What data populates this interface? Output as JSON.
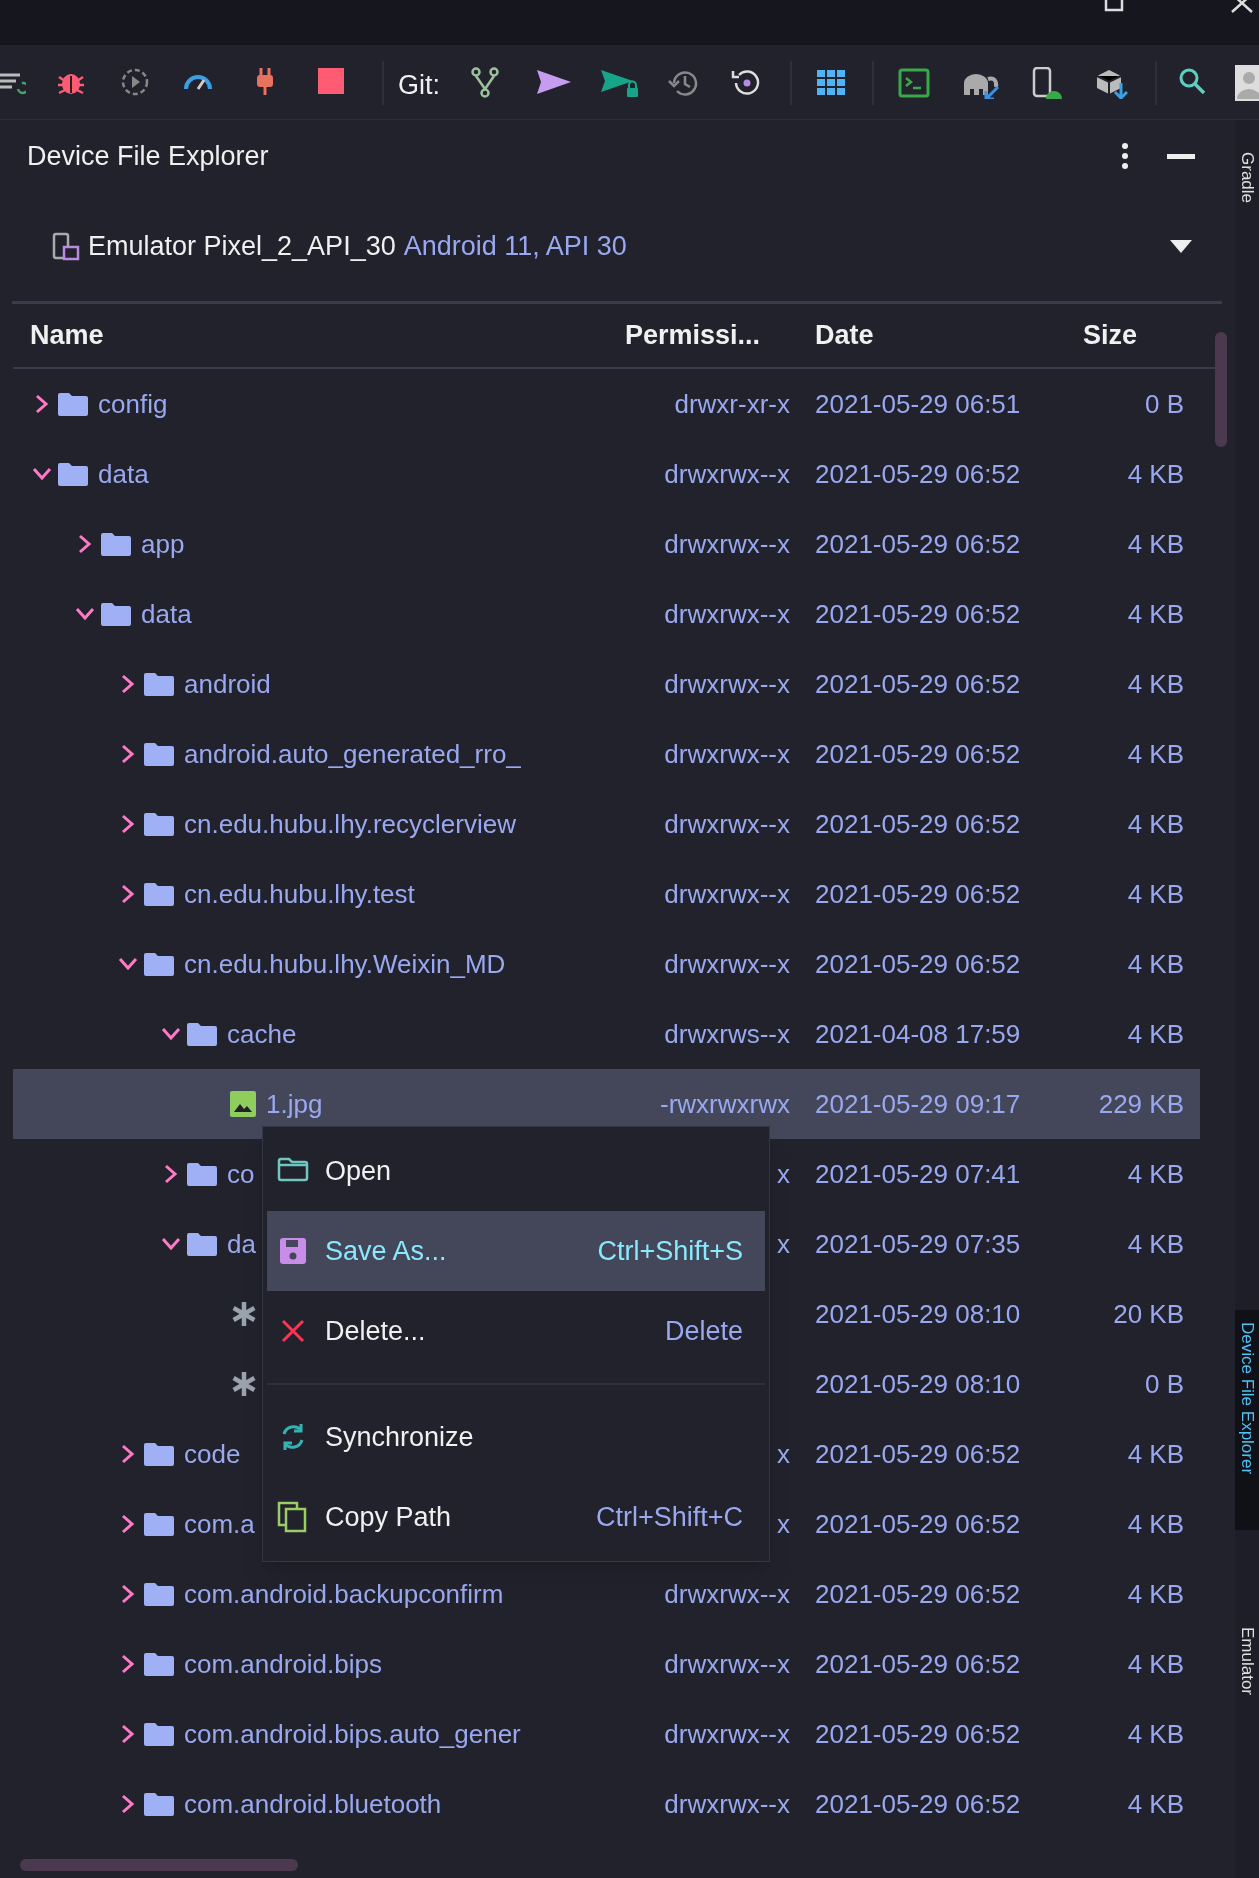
{
  "toolbar": {
    "git_label": "Git:"
  },
  "panel": {
    "title": "Device File Explorer"
  },
  "device": {
    "name": "Emulator Pixel_2_API_30",
    "api": "Android 11, API 30"
  },
  "columns": [
    "Name",
    "Permissi...",
    "Date",
    "Size"
  ],
  "rows": [
    {
      "kind": "folder",
      "name": "config",
      "permissions": "drwxr-xr-x",
      "date": "2021-05-29 06:51",
      "size": "0 B",
      "expanded": false,
      "selected": false
    },
    {
      "kind": "folder",
      "name": "data",
      "permissions": "drwxrwx--x",
      "date": "2021-05-29 06:52",
      "size": "4 KB",
      "expanded": true,
      "selected": false,
      "children": [
        {
          "kind": "folder",
          "name": "app",
          "permissions": "drwxrwx--x",
          "date": "2021-05-29 06:52",
          "size": "4 KB",
          "expanded": false,
          "selected": false
        },
        {
          "kind": "folder",
          "name": "data",
          "permissions": "drwxrwx--x",
          "date": "2021-05-29 06:52",
          "size": "4 KB",
          "expanded": true,
          "selected": false,
          "children": [
            {
              "kind": "folder",
              "name": "android",
              "permissions": "drwxrwx--x",
              "date": "2021-05-29 06:52",
              "size": "4 KB",
              "expanded": false,
              "selected": false
            },
            {
              "kind": "folder",
              "name": "android.auto_generated_rro_",
              "permissions": "drwxrwx--x",
              "date": "2021-05-29 06:52",
              "size": "4 KB",
              "expanded": false,
              "selected": false
            },
            {
              "kind": "folder",
              "name": "cn.edu.hubu.lhy.recyclerview",
              "permissions": "drwxrwx--x",
              "date": "2021-05-29 06:52",
              "size": "4 KB",
              "expanded": false,
              "selected": false
            },
            {
              "kind": "folder",
              "name": "cn.edu.hubu.lhy.test",
              "permissions": "drwxrwx--x",
              "date": "2021-05-29 06:52",
              "size": "4 KB",
              "expanded": false,
              "selected": false
            },
            {
              "kind": "folder",
              "name": "cn.edu.hubu.lhy.Weixin_MD",
              "permissions": "drwxrwx--x",
              "date": "2021-05-29 06:52",
              "size": "4 KB",
              "expanded": true,
              "selected": false,
              "children": [
                {
                  "kind": "folder",
                  "name": "cache",
                  "permissions": "drwxrws--x",
                  "date": "2021-04-08 17:59",
                  "size": "4 KB",
                  "expanded": true,
                  "selected": false,
                  "children": [
                    {
                      "kind": "image",
                      "name": "1.jpg",
                      "permissions": "-rwxrwxrwx",
                      "date": "2021-05-29 09:17",
                      "size": "229 KB",
                      "selected": true
                    }
                  ]
                },
                {
                  "kind": "folder",
                  "name": "co",
                  "permissions": "x",
                  "date": "2021-05-29 07:41",
                  "size": "4 KB",
                  "expanded": false,
                  "selected": false
                },
                {
                  "kind": "folder",
                  "name": "da",
                  "permissions": "x",
                  "date": "2021-05-29 07:35",
                  "size": "4 KB",
                  "expanded": true,
                  "selected": false,
                  "children": [
                    {
                      "kind": "file",
                      "date": "2021-05-29 08:10",
                      "size": "20 KB",
                      "selected": false
                    },
                    {
                      "kind": "file",
                      "date": "2021-05-29 08:10",
                      "size": "0 B",
                      "selected": false
                    }
                  ]
                }
              ]
            },
            {
              "kind": "folder",
              "name": "code",
              "permissions": "x",
              "date": "2021-05-29 06:52",
              "size": "4 KB",
              "expanded": false,
              "selected": false
            },
            {
              "kind": "folder",
              "name": "com.a",
              "permissions": "x",
              "date": "2021-05-29 06:52",
              "size": "4 KB",
              "expanded": false,
              "selected": false
            },
            {
              "kind": "folder",
              "name": "com.android.backupconfirm",
              "permissions": "drwxrwx--x",
              "date": "2021-05-29 06:52",
              "size": "4 KB",
              "expanded": false,
              "selected": false
            },
            {
              "kind": "folder",
              "name": "com.android.bips",
              "permissions": "drwxrwx--x",
              "date": "2021-05-29 06:52",
              "size": "4 KB",
              "expanded": false,
              "selected": false
            },
            {
              "kind": "folder",
              "name": "com.android.bips.auto_gener",
              "permissions": "drwxrwx--x",
              "date": "2021-05-29 06:52",
              "size": "4 KB",
              "expanded": false,
              "selected": false
            },
            {
              "kind": "folder",
              "name": "com.android.bluetooth",
              "permissions": "drwxrwx--x",
              "date": "2021-05-29 06:52",
              "size": "4 KB",
              "expanded": false,
              "selected": false
            }
          ]
        }
      ]
    }
  ],
  "context_menu": [
    {
      "label": "Open",
      "selected": false
    },
    {
      "label": "Save As...",
      "shortcut": "Ctrl+Shift+S",
      "selected": true
    },
    {
      "label": "Delete...",
      "shortcut": "Delete",
      "selected": false
    },
    {
      "label": "Synchronize",
      "selected": false
    },
    {
      "label": "Copy Path",
      "shortcut": "Ctrl+Shift+C",
      "selected": false
    }
  ],
  "side_tabs": [
    {
      "label": "Gradle",
      "selected": false
    },
    {
      "label": "Device File Explorer",
      "selected": true
    },
    {
      "label": "Emulator",
      "selected": false
    }
  ]
}
